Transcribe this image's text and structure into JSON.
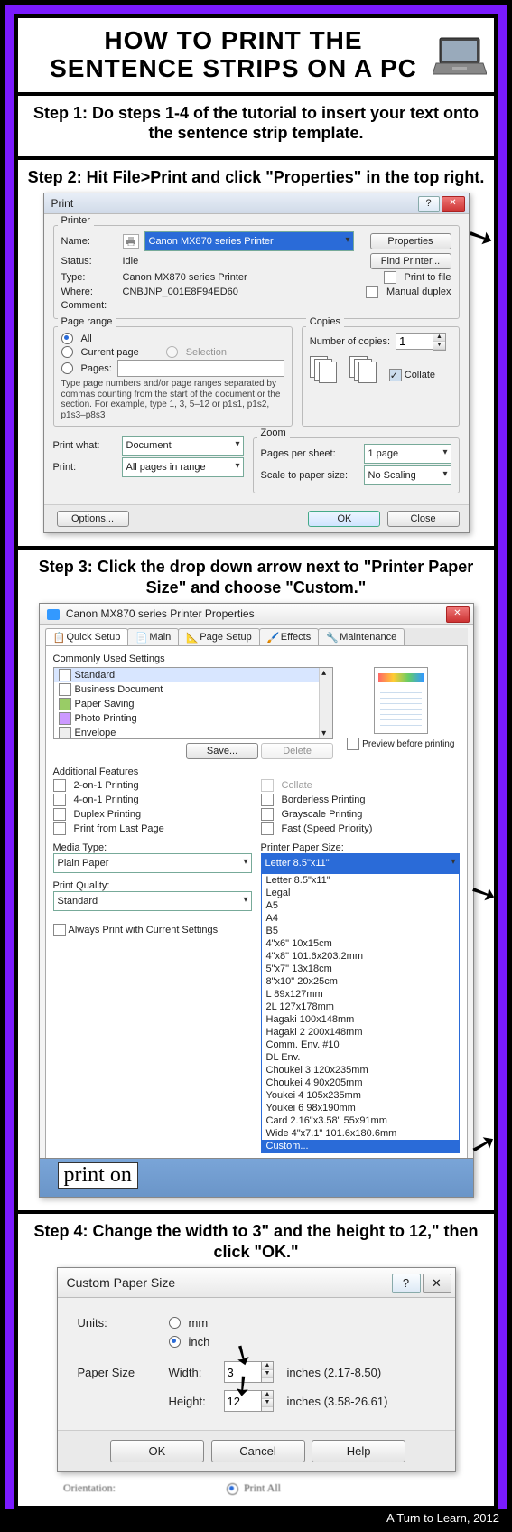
{
  "title_line1": "HOW TO PRINT THE",
  "title_line2": "SENTENCE STRIPS ON A PC",
  "step1": "Step 1: Do steps 1-4 of the tutorial to insert your text onto the sentence strip template.",
  "step2": "Step 2: Hit File>Print and click \"Properties\" in the top right.",
  "step3": "Step 3: Click the drop down arrow next to \"Printer Paper Size\" and choose \"Custom.\"",
  "step4": "Step 4: Change the width to 3\" and the height to 12,\" then click \"OK.\"",
  "print_dialog": {
    "title": "Print",
    "printer_group": "Printer",
    "name_lbl": "Name:",
    "name_val": "Canon MX870 series Printer",
    "status_lbl": "Status:",
    "status_val": "Idle",
    "type_lbl": "Type:",
    "type_val": "Canon MX870 series Printer",
    "where_lbl": "Where:",
    "where_val": "CNBJNP_001E8F94ED60",
    "comment_lbl": "Comment:",
    "properties_btn": "Properties",
    "find_printer_btn": "Find Printer...",
    "print_to_file": "Print to file",
    "manual_duplex": "Manual duplex",
    "page_range_group": "Page range",
    "all": "All",
    "current_page": "Current page",
    "selection": "Selection",
    "pages_lbl": "Pages:",
    "pages_note": "Type page numbers and/or page ranges separated by commas counting from the start of the document or the section. For example, type 1, 3, 5–12 or p1s1, p1s2, p1s3–p8s3",
    "copies_group": "Copies",
    "num_copies_lbl": "Number of copies:",
    "num_copies_val": "1",
    "collate": "Collate",
    "print_what_lbl": "Print what:",
    "print_what_val": "Document",
    "print_lbl": "Print:",
    "print_val": "All pages in range",
    "zoom_group": "Zoom",
    "pps_lbl": "Pages per sheet:",
    "pps_val": "1 page",
    "scale_lbl": "Scale to paper size:",
    "scale_val": "No Scaling",
    "options_btn": "Options...",
    "ok_btn": "OK",
    "close_btn": "Close"
  },
  "props_dialog": {
    "title": "Canon MX870 series Printer Properties",
    "tabs": [
      "Quick Setup",
      "Main",
      "Page Setup",
      "Effects",
      "Maintenance"
    ],
    "commonly_used": "Commonly Used Settings",
    "settings_list": [
      "Standard",
      "Business Document",
      "Paper Saving",
      "Photo Printing",
      "Envelope"
    ],
    "save_btn": "Save...",
    "delete_btn": "Delete",
    "preview_chk": "Preview before printing",
    "additional_features": "Additional Features",
    "feat_left": [
      "2-on-1 Printing",
      "4-on-1 Printing",
      "Duplex Printing",
      "Print from Last Page"
    ],
    "feat_right": [
      "Collate",
      "Borderless Printing",
      "Grayscale Printing",
      "Fast (Speed Priority)"
    ],
    "media_type_lbl": "Media Type:",
    "media_type_val": "Plain Paper",
    "print_quality_lbl": "Print Quality:",
    "print_quality_val": "Standard",
    "paper_size_lbl": "Printer Paper Size:",
    "paper_size_val": "Letter 8.5\"x11\"",
    "always_print": "Always Print with Current Settings",
    "paper_options": [
      "Letter 8.5\"x11\"",
      "Legal",
      "A5",
      "A4",
      "B5",
      "4\"x6\" 10x15cm",
      "4\"x8\" 101.6x203.2mm",
      "5\"x7\" 13x18cm",
      "8\"x10\" 20x25cm",
      "L 89x127mm",
      "2L 127x178mm",
      "Hagaki 100x148mm",
      "Hagaki 2 200x148mm",
      "Comm. Env. #10",
      "DL Env.",
      "Choukei 3 120x235mm",
      "Choukei 4 90x205mm",
      "Youkei 4 105x235mm",
      "Youkei 6 98x190mm",
      "Card 2.16\"x3.58\" 55x91mm",
      "Wide 4\"x7.1\" 101.6x180.6mm",
      "Custom..."
    ],
    "print_on_text": "print on"
  },
  "custom_dialog": {
    "title": "Custom Paper Size",
    "units_lbl": "Units:",
    "mm": "mm",
    "inch": "inch",
    "paper_size_lbl": "Paper Size",
    "width_lbl": "Width:",
    "width_val": "3",
    "width_range": "inches (2.17-8.50)",
    "height_lbl": "Height:",
    "height_val": "12",
    "height_range": "inches (3.58-26.61)",
    "ok": "OK",
    "cancel": "Cancel",
    "help": "Help",
    "orientation": "Orientation:",
    "print_all": "Print All"
  },
  "credit": "A Turn to Learn, 2012"
}
